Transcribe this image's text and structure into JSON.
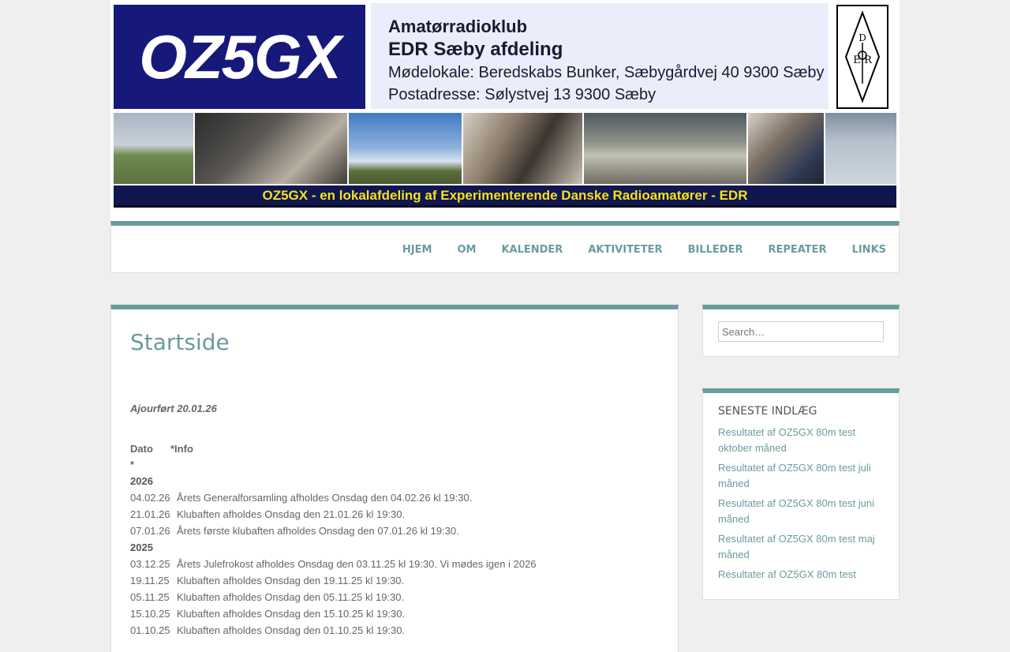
{
  "banner": {
    "logo_text": "OZ5GX",
    "line1": "Amatørradioklub",
    "line2": "EDR Sæby afdeling",
    "line3": "Mødelokale: Beredskabs Bunker, Sæbygårdvej 40 9300 Sæby",
    "line4": "Postadresse: Sølystvej 13 9300 Sæby",
    "seal_text": "EDR",
    "tagline": "OZ5GX - en lokalafdeling af Experimenterende Danske Radioamatører - EDR"
  },
  "nav": {
    "items": [
      "HJEM",
      "OM",
      "KALENDER",
      "AKTIVITETER",
      "BILLEDER",
      "REPEATER",
      "LINKS"
    ]
  },
  "main": {
    "title": "Startside",
    "updated": "Ajourført 20.01.26",
    "col_date": "Dato",
    "col_info": "*Info",
    "star": "*",
    "year_2026": "2026",
    "rows_2026": [
      {
        "date": "04.02.26",
        "text": "Årets Generalforsamling afholdes Onsdag den 04.02.26 kl 19:30."
      },
      {
        "date": "21.01.26",
        "text": "Klubaften afholdes Onsdag den 21.01.26 kl 19:30."
      },
      {
        "date": "07.01.26",
        "text": "Årets første klubaften afholdes Onsdag den 07.01.26 kl 19:30."
      }
    ],
    "year_2025": "2025",
    "rows_2025": [
      {
        "date": "03.12.25",
        "text": "Årets Julefrokost afholdes Onsdag den 03.11.25 kl 19:30. Vi mødes igen i 2026"
      },
      {
        "date": "19.11.25",
        "text": "Klubaften afholdes Onsdag den 19.11.25 kl 19:30."
      },
      {
        "date": "05.11.25",
        "text": "Klubaften afholdes Onsdag den 05.11.25 kl 19:30."
      },
      {
        "date": "15.10.25",
        "text": "Klubaften afholdes Onsdag den 15.10.25 kl 19:30."
      },
      {
        "date": "01.10.25",
        "text": "Klubaften afholdes Onsdag den 01.10.25 kl 19:30."
      }
    ]
  },
  "sidebar": {
    "search_placeholder": "Search…",
    "recent_title": "SENESTE INDLÆG",
    "recent": [
      "Resultatet af OZ5GX 80m test oktober måned",
      "Resultatet af OZ5GX 80m test juli måned",
      "Resultatet af OZ5GX 80m test juni måned",
      "Resultatet af OZ5GX 80m test maj måned",
      "Resultater af OZ5GX 80m test"
    ]
  },
  "colors": {
    "accent": "#6a9b9e",
    "banner_blue": "#16187a",
    "tagline_yellow": "#f4e11b"
  }
}
